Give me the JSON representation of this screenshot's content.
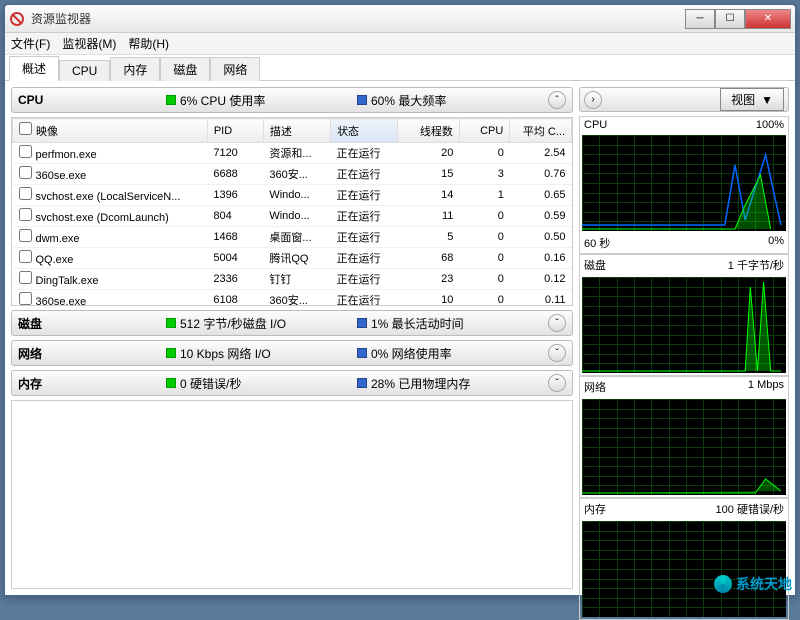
{
  "window": {
    "title": "资源监视器"
  },
  "menu": {
    "file": "文件(F)",
    "monitor": "监视器(M)",
    "help": "帮助(H)"
  },
  "tabs": [
    "概述",
    "CPU",
    "内存",
    "磁盘",
    "网络"
  ],
  "cpu": {
    "title": "CPU",
    "usage": "6% CPU 使用率",
    "freq": "60% 最大频率",
    "columns": {
      "image": "映像",
      "pid": "PID",
      "desc": "描述",
      "status": "状态",
      "threads": "线程数",
      "cpu": "CPU",
      "avg": "平均 C..."
    },
    "rows": [
      {
        "image": "perfmon.exe",
        "pid": "7120",
        "desc": "资源和...",
        "status": "正在运行",
        "threads": "20",
        "cpu": "0",
        "avg": "2.54"
      },
      {
        "image": "360se.exe",
        "pid": "6688",
        "desc": "360安...",
        "status": "正在运行",
        "threads": "15",
        "cpu": "3",
        "avg": "0.76"
      },
      {
        "image": "svchost.exe (LocalServiceN...",
        "pid": "1396",
        "desc": "Windo...",
        "status": "正在运行",
        "threads": "14",
        "cpu": "1",
        "avg": "0.65"
      },
      {
        "image": "svchost.exe (DcomLaunch)",
        "pid": "804",
        "desc": "Windo...",
        "status": "正在运行",
        "threads": "11",
        "cpu": "0",
        "avg": "0.59"
      },
      {
        "image": "dwm.exe",
        "pid": "1468",
        "desc": "桌面窗...",
        "status": "正在运行",
        "threads": "5",
        "cpu": "0",
        "avg": "0.50"
      },
      {
        "image": "QQ.exe",
        "pid": "5004",
        "desc": "腾讯QQ",
        "status": "正在运行",
        "threads": "68",
        "cpu": "0",
        "avg": "0.16"
      },
      {
        "image": "DingTalk.exe",
        "pid": "2336",
        "desc": "钉钉",
        "status": "正在运行",
        "threads": "23",
        "cpu": "0",
        "avg": "0.12"
      },
      {
        "image": "360se.exe",
        "pid": "6108",
        "desc": "360安...",
        "status": "正在运行",
        "threads": "10",
        "cpu": "0",
        "avg": "0.11"
      }
    ]
  },
  "disk": {
    "title": "磁盘",
    "io": "512 字节/秒磁盘 I/O",
    "active": "1% 最长活动时间"
  },
  "net": {
    "title": "网络",
    "io": "10 Kbps 网络 I/O",
    "usage": "0% 网络使用率"
  },
  "mem": {
    "title": "内存",
    "faults": "0 硬错误/秒",
    "used": "28% 已用物理内存"
  },
  "rightPanel": {
    "viewBtn": "视图",
    "graphs": [
      {
        "title": "CPU",
        "right": "100%",
        "ftrL": "60 秒",
        "ftrR": "0%"
      },
      {
        "title": "磁盘",
        "right": "1 千字节/秒",
        "ftrL": "",
        "ftrR": ""
      },
      {
        "title": "网络",
        "right": "1 Mbps",
        "ftrL": "",
        "ftrR": ""
      },
      {
        "title": "内存",
        "right": "100 硬错误/秒",
        "ftrL": "",
        "ftrR": ""
      }
    ]
  },
  "watermark": "系统天地"
}
